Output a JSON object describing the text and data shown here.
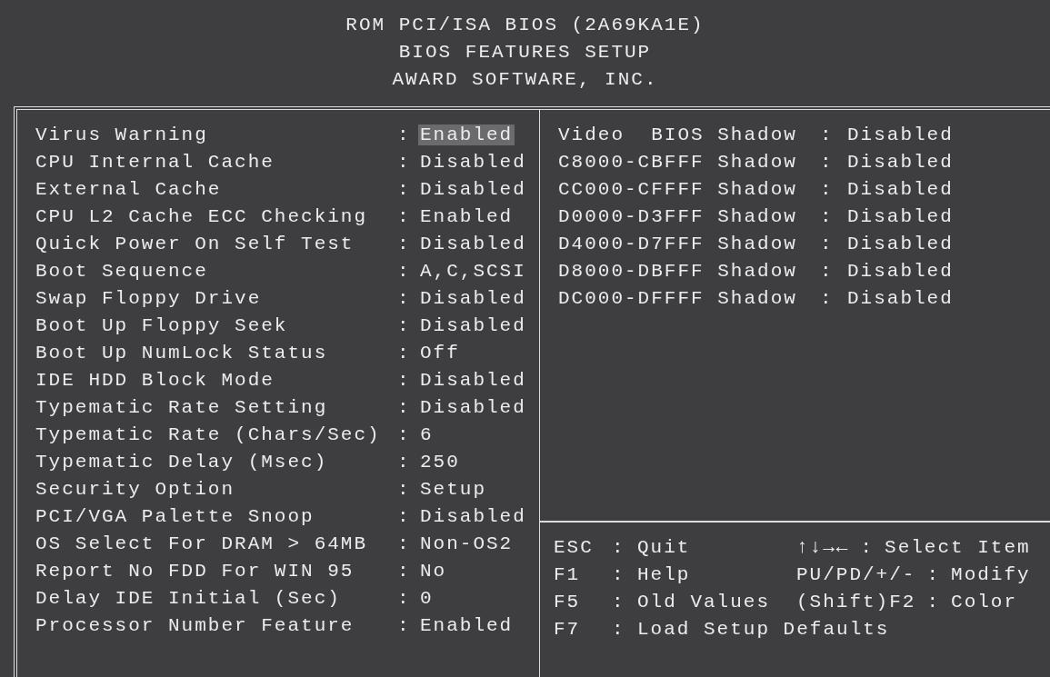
{
  "header": [
    "ROM PCI/ISA BIOS (2A69KA1E)",
    "BIOS FEATURES SETUP",
    "AWARD SOFTWARE, INC."
  ],
  "settings": [
    {
      "label": "Virus Warning",
      "sep": ":",
      "value": "Enabled",
      "selected": true
    },
    {
      "label": "CPU Internal Cache",
      "sep": ":",
      "value": "Disabled",
      "selected": false
    },
    {
      "label": "External Cache",
      "sep": ":",
      "value": "Disabled",
      "selected": false
    },
    {
      "label": "CPU L2 Cache ECC Checking",
      "sep": ":",
      "value": "Enabled",
      "selected": false
    },
    {
      "label": "Quick Power On Self Test",
      "sep": ":",
      "value": "Disabled",
      "selected": false
    },
    {
      "label": "Boot Sequence",
      "sep": ":",
      "value": "A,C,SCSI",
      "selected": false
    },
    {
      "label": "Swap Floppy Drive",
      "sep": ":",
      "value": "Disabled",
      "selected": false
    },
    {
      "label": "Boot Up Floppy Seek",
      "sep": ":",
      "value": "Disabled",
      "selected": false
    },
    {
      "label": "Boot Up NumLock Status",
      "sep": ":",
      "value": "Off",
      "selected": false
    },
    {
      "label": "IDE HDD Block Mode",
      "sep": ":",
      "value": "Disabled",
      "selected": false
    },
    {
      "label": "Typematic Rate Setting",
      "sep": ":",
      "value": "Disabled",
      "selected": false
    },
    {
      "label": "Typematic Rate (Chars/Sec)",
      "sep": ":",
      "value": "6",
      "selected": false
    },
    {
      "label": "Typematic Delay (Msec)",
      "sep": ":",
      "value": "250",
      "selected": false
    },
    {
      "label": "Security Option",
      "sep": ":",
      "value": "Setup",
      "selected": false
    },
    {
      "label": "PCI/VGA Palette Snoop",
      "sep": ":",
      "value": "Disabled",
      "selected": false
    },
    {
      "label": "OS Select For DRAM > 64MB",
      "sep": ":",
      "value": "Non-OS2",
      "selected": false
    },
    {
      "label": "Report No FDD For WIN 95",
      "sep": ":",
      "value": "No",
      "selected": false
    },
    {
      "label": "Delay IDE Initial (Sec)",
      "sep": ":",
      "value": "0",
      "selected": false
    },
    {
      "label": "Processor Number Feature",
      "sep": ":",
      "value": "Enabled",
      "selected": false
    }
  ],
  "shadows": [
    {
      "label": "Video  BIOS Shadow",
      "sep": ":",
      "value": "Disabled",
      "selected": false
    },
    {
      "label": "C8000-CBFFF Shadow",
      "sep": ":",
      "value": "Disabled",
      "selected": false
    },
    {
      "label": "CC000-CFFFF Shadow",
      "sep": ":",
      "value": "Disabled",
      "selected": false
    },
    {
      "label": "D0000-D3FFF Shadow",
      "sep": ":",
      "value": "Disabled",
      "selected": false
    },
    {
      "label": "D4000-D7FFF Shadow",
      "sep": ":",
      "value": "Disabled",
      "selected": false
    },
    {
      "label": "D8000-DBFFF Shadow",
      "sep": ":",
      "value": "Disabled",
      "selected": false
    },
    {
      "label": "DC000-DFFFF Shadow",
      "sep": ":",
      "value": "Disabled",
      "selected": false
    }
  ],
  "help": [
    {
      "key": "ESC",
      "sep": ":",
      "action": "Quit",
      "key2": "↑↓→←",
      "sep2": ":",
      "action2": "Select Item"
    },
    {
      "key": "F1",
      "sep": ":",
      "action": "Help",
      "key2": "PU/PD/+/-",
      "sep2": ":",
      "action2": "Modify"
    },
    {
      "key": "F5",
      "sep": ":",
      "action": "Old Values",
      "key2": "(Shift)F2",
      "sep2": ":",
      "action2": "Color"
    },
    {
      "key": "F7",
      "sep": ":",
      "action": "Load Setup Defaults"
    }
  ]
}
